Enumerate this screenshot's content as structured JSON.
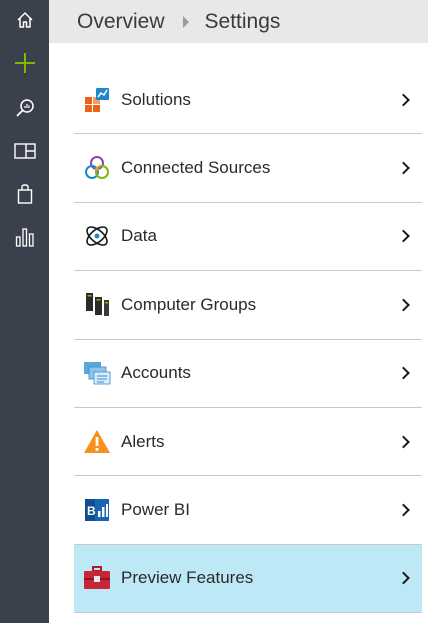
{
  "breadcrumb": {
    "root": "Overview",
    "current": "Settings"
  },
  "rail": {
    "items": [
      {
        "icon": "home-icon"
      },
      {
        "icon": "plus-icon",
        "color": "#7fba00"
      },
      {
        "icon": "log-search-icon"
      },
      {
        "icon": "view-designer-icon"
      },
      {
        "icon": "solutions-gallery-icon"
      },
      {
        "icon": "usage-chart-icon"
      }
    ]
  },
  "settings": {
    "items": [
      {
        "label": "Solutions",
        "icon": "solutions-icon"
      },
      {
        "label": "Connected Sources",
        "icon": "connected-sources-icon"
      },
      {
        "label": "Data",
        "icon": "data-icon"
      },
      {
        "label": "Computer Groups",
        "icon": "computer-groups-icon"
      },
      {
        "label": "Accounts",
        "icon": "accounts-icon"
      },
      {
        "label": "Alerts",
        "icon": "alerts-icon"
      },
      {
        "label": "Power BI",
        "icon": "power-bi-icon"
      },
      {
        "label": "Preview Features",
        "icon": "preview-features-icon",
        "selected": true
      }
    ]
  },
  "colors": {
    "rail": "#3a414d",
    "header": "#e8e8e8",
    "selected_row": "#bde9f7",
    "accent_green": "#7fba00",
    "alert_orange": "#f7901e"
  }
}
